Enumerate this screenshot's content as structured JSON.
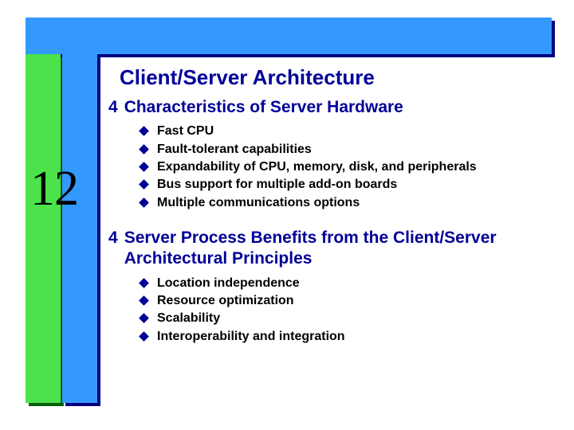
{
  "chapter_number": "12",
  "title": "Client/Server Architecture",
  "bullet_glyph": "4",
  "sections": [
    {
      "heading": "Characteristics of Server Hardware",
      "items": [
        "Fast CPU",
        "Fault-tolerant capabilities",
        "Expandability of CPU, memory, disk, and peripherals",
        "Bus support for multiple add-on boards",
        "Multiple communications options"
      ]
    },
    {
      "heading": "Server Process Benefits from the Client/Server Architectural Principles",
      "items": [
        "Location independence",
        "Resource optimization",
        "Scalability",
        "Interoperability and integration"
      ]
    }
  ],
  "colors": {
    "accent_blue": "#3399ff",
    "accent_green": "#4be24b",
    "title_navy": "#000099"
  }
}
